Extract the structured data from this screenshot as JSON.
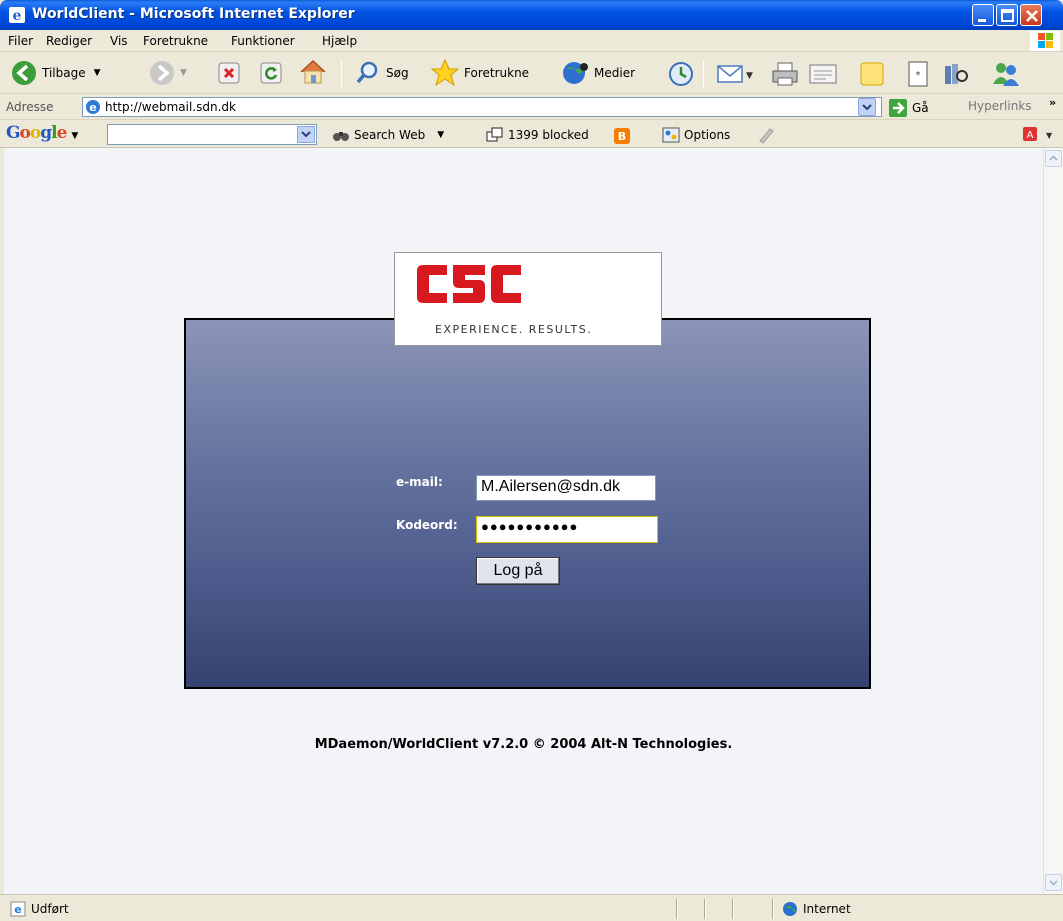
{
  "window": {
    "title": "WorldClient - Microsoft Internet Explorer"
  },
  "menu": [
    "Filer",
    "Rediger",
    "Vis",
    "Foretrukne",
    "Funktioner",
    "Hjælp"
  ],
  "toolbar": {
    "back": "Tilbage",
    "search": "Søg",
    "favorites": "Foretrukne",
    "media": "Medier"
  },
  "address": {
    "label": "Adresse",
    "url": "http://webmail.sdn.dk",
    "go": "Gå",
    "links": "Hyperlinks"
  },
  "google": {
    "logo": "Google",
    "search_web": "Search Web",
    "blocked": "1399 blocked",
    "options": "Options"
  },
  "login": {
    "logo_text": "CSC",
    "tagline": "EXPERIENCE. RESULTS.",
    "email_label": "e-mail:",
    "email_value": "M.Ailersen@sdn.dk",
    "password_label": "Kodeord:",
    "password_value": "●●●●●●●●●●●",
    "button": "Log på"
  },
  "footer": "MDaemon/WorldClient v7.2.0 © 2004 Alt-N Technologies.",
  "status": {
    "left": "Udført",
    "zone": "Internet"
  },
  "colors": {
    "title_blue": "#0054e3",
    "login_top": "#8b95b8",
    "login_bottom": "#35426f"
  }
}
